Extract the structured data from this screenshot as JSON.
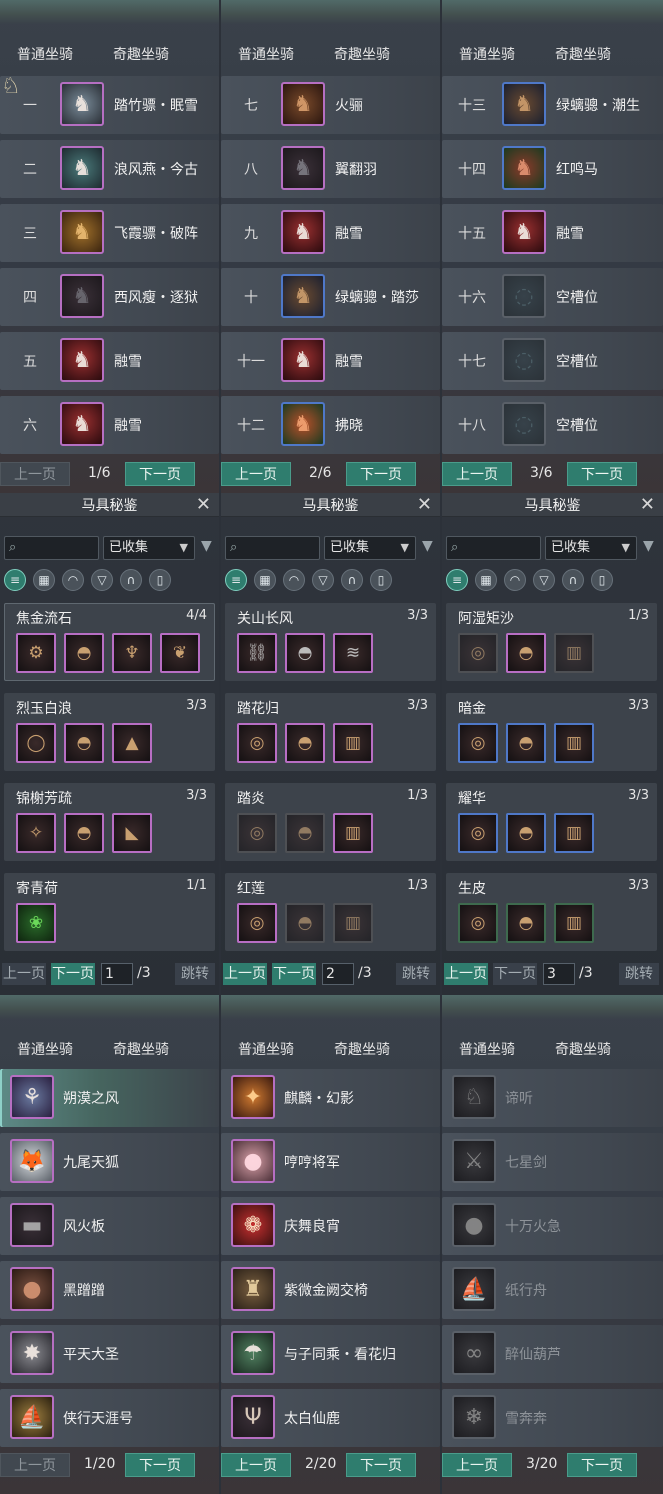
{
  "tabs": {
    "normal": "普通坐骑",
    "quirky": "奇趣坐骑"
  },
  "pager": {
    "prev": "上一页",
    "next": "下一页"
  },
  "mount_pages": [
    {
      "page": "1/6",
      "rows": [
        {
          "num": "一",
          "name": "踏竹骠・眠雪"
        },
        {
          "num": "二",
          "name": "浪风燕・今古"
        },
        {
          "num": "三",
          "name": "飞霞骠・破阵"
        },
        {
          "num": "四",
          "name": "西风瘦・逐狱"
        },
        {
          "num": "五",
          "name": "融雪"
        },
        {
          "num": "六",
          "name": "融雪"
        }
      ]
    },
    {
      "page": "2/6",
      "rows": [
        {
          "num": "七",
          "name": "火骊"
        },
        {
          "num": "八",
          "name": "翼翻羽"
        },
        {
          "num": "九",
          "name": "融雪"
        },
        {
          "num": "十",
          "name": "绿螭骢・踏莎"
        },
        {
          "num": "十一",
          "name": "融雪"
        },
        {
          "num": "十二",
          "name": "拂晓"
        }
      ]
    },
    {
      "page": "3/6",
      "rows": [
        {
          "num": "十三",
          "name": "绿螭骢・潮生"
        },
        {
          "num": "十四",
          "name": "红鸣马"
        },
        {
          "num": "十五",
          "name": "融雪"
        },
        {
          "num": "十六",
          "name": "空槽位"
        },
        {
          "num": "十七",
          "name": "空槽位"
        },
        {
          "num": "十八",
          "name": "空槽位"
        }
      ]
    }
  ],
  "tack": {
    "title": "马具秘鉴",
    "close_icon": "close-icon",
    "filter_value": "已收集",
    "jump": "跳转",
    "total": "/3",
    "pages": [
      {
        "current": "1",
        "sets": [
          {
            "name": "焦金流石",
            "count": "4/4"
          },
          {
            "name": "烈玉白浪",
            "count": "3/3"
          },
          {
            "name": "锦榭芳疏",
            "count": "3/3"
          },
          {
            "name": "寄青荷",
            "count": "1/1"
          }
        ]
      },
      {
        "current": "2",
        "sets": [
          {
            "name": "关山长风",
            "count": "3/3"
          },
          {
            "name": "踏花归",
            "count": "3/3"
          },
          {
            "name": "踏炎",
            "count": "1/3"
          },
          {
            "name": "红莲",
            "count": "1/3"
          }
        ]
      },
      {
        "current": "3",
        "sets": [
          {
            "name": "阿湿矩沙",
            "count": "1/3"
          },
          {
            "name": "暗金",
            "count": "3/3"
          },
          {
            "name": "耀华",
            "count": "3/3"
          },
          {
            "name": "生皮",
            "count": "3/3"
          }
        ]
      }
    ]
  },
  "quirky_pages": [
    {
      "page": "1/20",
      "rows": [
        {
          "name": "朔漠之风"
        },
        {
          "name": "九尾天狐"
        },
        {
          "name": "风火板"
        },
        {
          "name": "黑蹭蹭"
        },
        {
          "name": "平天大圣"
        },
        {
          "name": "侠行天涯号"
        }
      ]
    },
    {
      "page": "2/20",
      "rows": [
        {
          "name": "麒麟・幻影"
        },
        {
          "name": "哼哼将军"
        },
        {
          "name": "庆舞良宵"
        },
        {
          "name": "紫微金阙交椅"
        },
        {
          "name": "与子同乘・看花归"
        },
        {
          "name": "太白仙鹿"
        }
      ]
    },
    {
      "page": "3/20",
      "rows": [
        {
          "name": "谛听"
        },
        {
          "name": "七星剑"
        },
        {
          "name": "十万火急"
        },
        {
          "name": "纸行舟"
        },
        {
          "name": "醉仙葫芦"
        },
        {
          "name": "雪奔奔"
        }
      ]
    }
  ]
}
